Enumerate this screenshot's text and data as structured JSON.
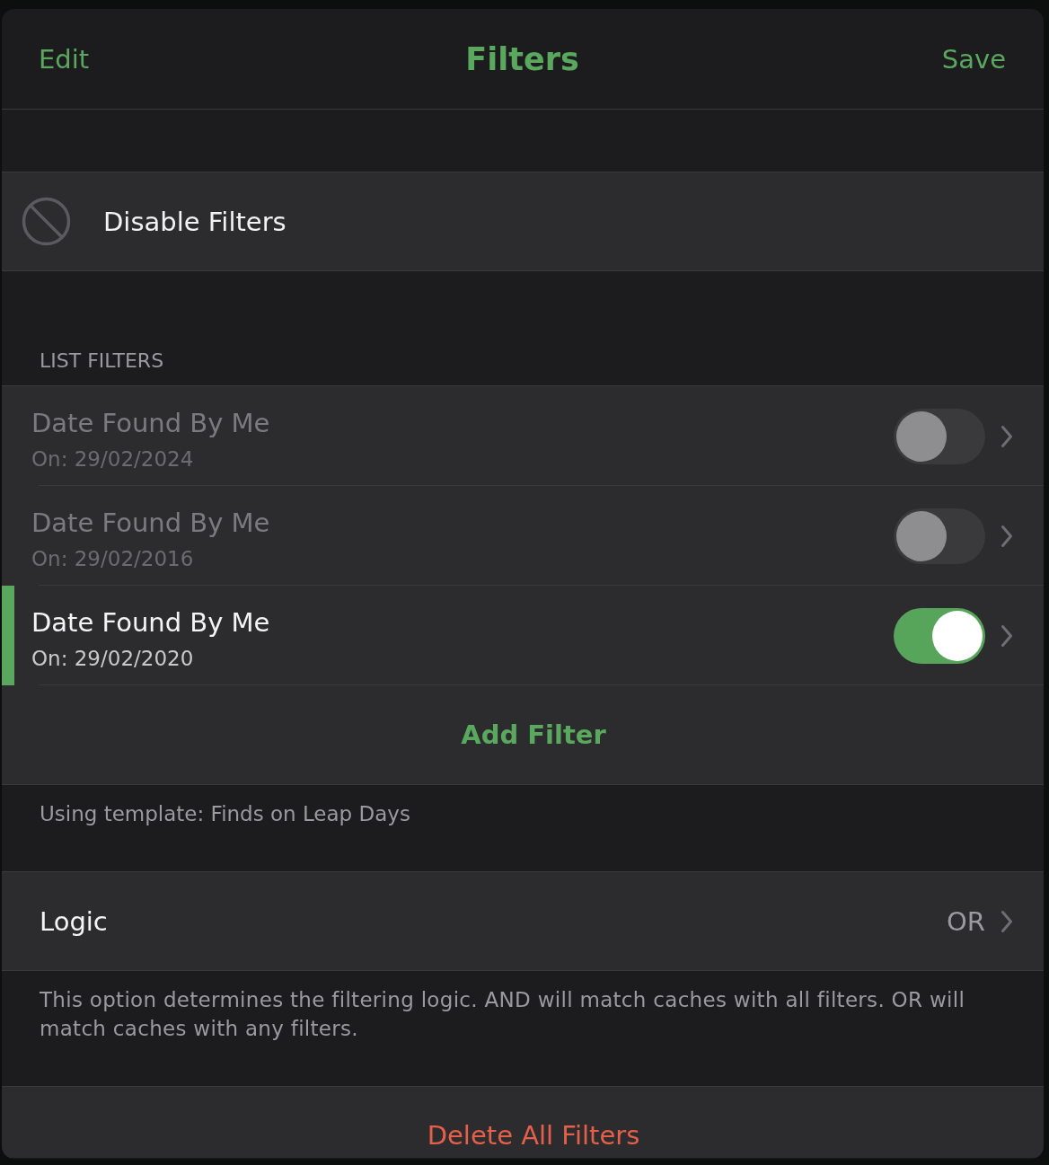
{
  "nav_bar": {
    "left_button": "Edit",
    "title": "Filters",
    "right_button": "Save"
  },
  "disable_row": {
    "label": "Disable Filters"
  },
  "list_filters": {
    "header": "LIST FILTERS",
    "items": [
      {
        "title": "Date Found By Me",
        "subtitle": "On: 29/02/2024",
        "on": false,
        "selected": false
      },
      {
        "title": "Date Found By Me",
        "subtitle": "On: 29/02/2016",
        "on": false,
        "selected": false
      },
      {
        "title": "Date Found By Me",
        "subtitle": "On: 29/02/2020",
        "on": true,
        "selected": true
      }
    ],
    "add_button": "Add Filter",
    "footer": "Using template: Finds on Leap Days"
  },
  "logic": {
    "label": "Logic",
    "value": "OR",
    "footer": "This option determines the filtering logic. AND will match caches with all filters. OR will match caches with any filters."
  },
  "delete_button": "Delete All Filters"
}
